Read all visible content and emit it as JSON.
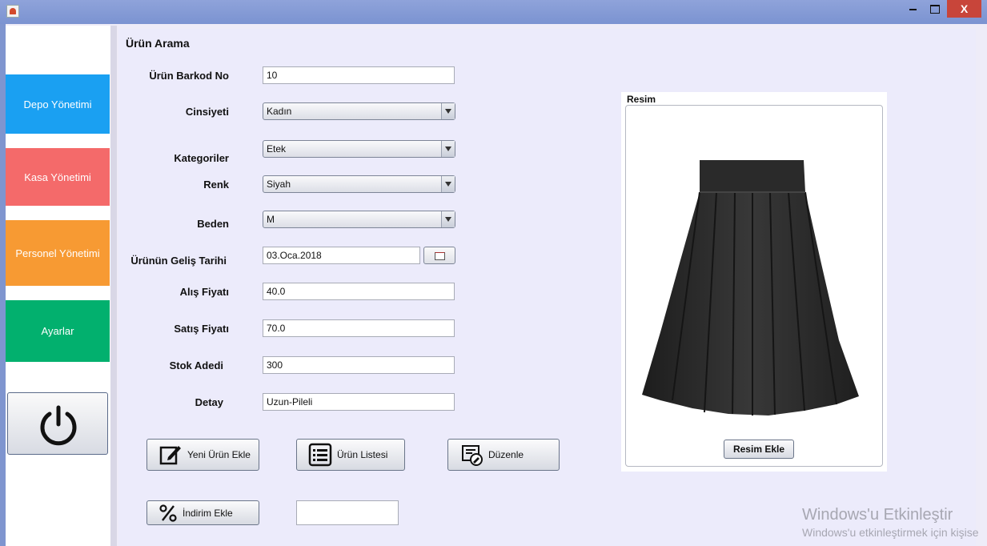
{
  "window": {
    "close_label": "X",
    "app_icon": "java-cup-icon"
  },
  "sidebar": {
    "items": [
      {
        "label": "Depo Yönetimi",
        "color": "#1aa0f2"
      },
      {
        "label": "Kasa Yönetimi",
        "color": "#f46a6a"
      },
      {
        "label": "Personel Yönetimi",
        "color": "#f79a33"
      },
      {
        "label": "Ayarlar",
        "color": "#02b06e"
      }
    ],
    "power_icon": "power-icon"
  },
  "form": {
    "title": "Ürün Arama",
    "barkod": {
      "label": "Ürün Barkod No",
      "value": "10"
    },
    "cinsiyet": {
      "label": "Cinsiyeti",
      "value": "Kadın"
    },
    "kategori": {
      "label": "Kategoriler",
      "value": "Etek"
    },
    "renk": {
      "label": "Renk",
      "value": "Siyah"
    },
    "beden": {
      "label": "Beden",
      "value": "M"
    },
    "gelis_tarihi": {
      "label": "Ürünün Geliş Tarihi",
      "value": "03.Oca.2018"
    },
    "alis_fiyati": {
      "label": "Alış Fiyatı",
      "value": "40.0"
    },
    "satis_fiyati": {
      "label": "Satış Fiyatı",
      "value": "70.0"
    },
    "stok_adedi": {
      "label": "Stok Adedi",
      "value": "300"
    },
    "detay": {
      "label": "Detay",
      "value": "Uzun-Pileli"
    }
  },
  "actions": {
    "yeni_urun": "Yeni Ürün Ekle",
    "urun_listesi": "Ürün Listesi",
    "duzenle": "Düzenle",
    "indirim": "İndirim Ekle",
    "indirim_value": ""
  },
  "image_panel": {
    "title": "Resim",
    "button": "Resim Ekle"
  },
  "watermark": {
    "title": "Windows'u Etkinleştir",
    "subtitle": "Windows'u etkinleştirmek için kişise"
  }
}
